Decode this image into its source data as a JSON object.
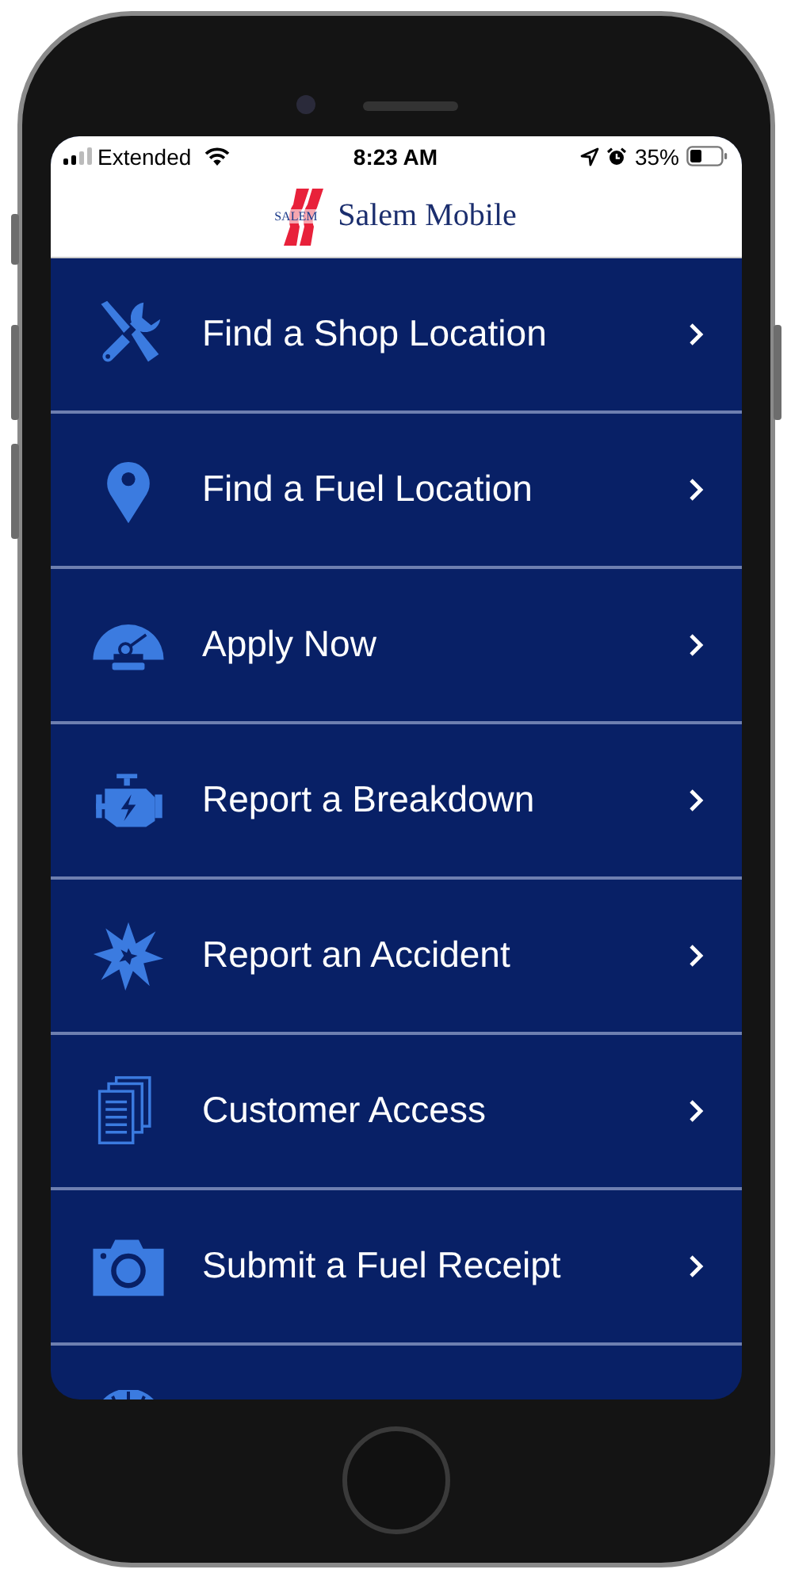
{
  "status_bar": {
    "carrier": "Extended",
    "time": "8:23 AM",
    "battery": "35%"
  },
  "header": {
    "logo_text": "SALEM",
    "title": "Salem Mobile"
  },
  "menu": [
    {
      "kind": "row",
      "label": "Find a Shop Location"
    },
    {
      "kind": "row",
      "label": "Find a Fuel Location"
    },
    {
      "kind": "row",
      "label": "Apply Now"
    },
    {
      "kind": "row",
      "label": "Report a Breakdown"
    },
    {
      "kind": "row",
      "label": "Report an Accident"
    },
    {
      "kind": "row",
      "label": "Customer Access"
    },
    {
      "kind": "row",
      "label": "Submit a Fuel Receipt"
    },
    {
      "kind": "partial"
    }
  ]
}
